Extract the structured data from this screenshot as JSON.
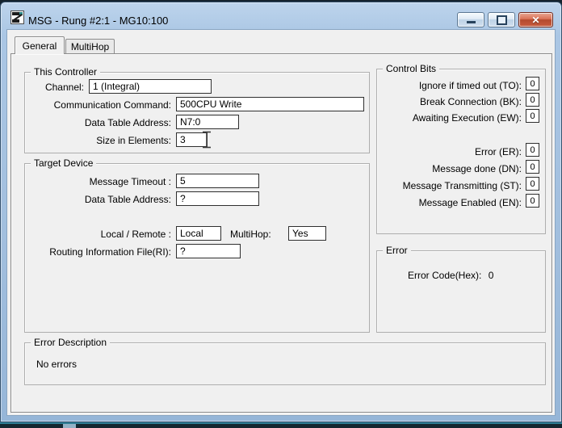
{
  "icons": {
    "close_glyph": "✕"
  },
  "window": {
    "title": "MSG - Rung #2:1 - MG10:100"
  },
  "tabs": {
    "general": "General",
    "multihop": "MultiHop"
  },
  "this_controller": {
    "legend": "This Controller",
    "channel": {
      "label": "Channel:",
      "value": "1 (Integral)"
    },
    "comm_command": {
      "label": "Communication Command:",
      "value": "500CPU Write"
    },
    "data_table_address": {
      "label": "Data Table Address:",
      "value": "N7:0"
    },
    "size_in_elements": {
      "label": "Size in Elements:",
      "value": "3"
    }
  },
  "target_device": {
    "legend": "Target Device",
    "message_timeout": {
      "label": "Message Timeout :",
      "value": "5"
    },
    "data_table_address": {
      "label": "Data Table Address:",
      "value": "?"
    },
    "local_remote": {
      "label": "Local / Remote :",
      "value": "Local"
    },
    "multihop": {
      "label": "MultiHop:",
      "value": "Yes"
    },
    "routing_file": {
      "label": "Routing Information File(RI):",
      "value": "?"
    }
  },
  "control_bits": {
    "legend": "Control Bits",
    "bits": [
      {
        "label": "Ignore if timed out (TO):",
        "value": "0"
      },
      {
        "label": "Break Connection (BK):",
        "value": "0"
      },
      {
        "label": "Awaiting Execution (EW):",
        "value": "0"
      },
      {
        "label": "Error (ER):",
        "value": "0"
      },
      {
        "label": "Message done (DN):",
        "value": "0"
      },
      {
        "label": "Message Transmitting (ST):",
        "value": "0"
      },
      {
        "label": "Message Enabled (EN):",
        "value": "0"
      }
    ]
  },
  "error": {
    "legend": "Error",
    "label": "Error Code(Hex):",
    "value": "0"
  },
  "error_description": {
    "legend": "Error Description",
    "text": "No errors"
  }
}
